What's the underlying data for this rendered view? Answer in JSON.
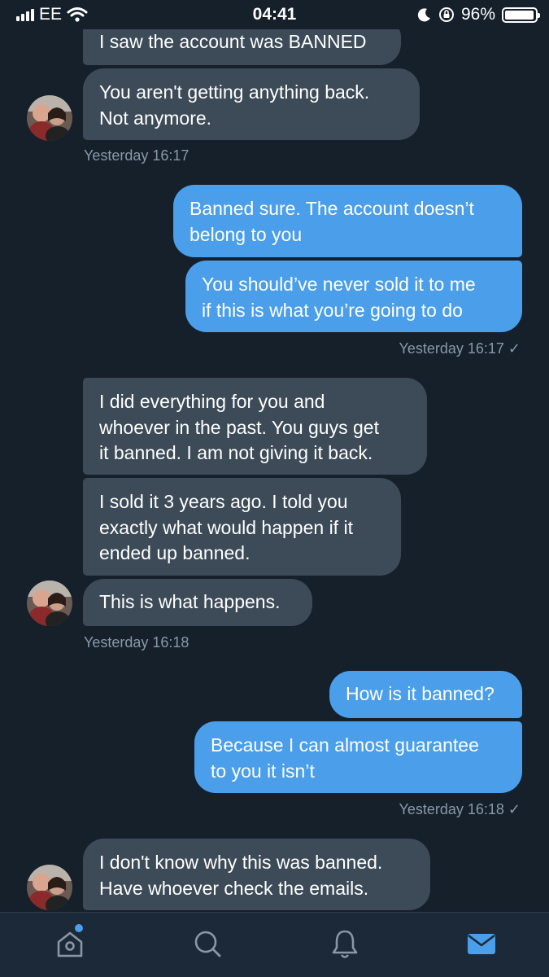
{
  "status_bar": {
    "carrier": "EE",
    "time": "04:41",
    "battery_percent": "96%",
    "battery_level": 0.96
  },
  "conversation": {
    "messages": [
      {
        "text": "I saw the account was BANNED"
      },
      {
        "text": "You aren't getting anything back.\nNot anymore."
      },
      {
        "text": "Banned sure. The account doesn’t\nbelong to you"
      },
      {
        "text": "You should’ve never sold it to me\nif this is what you’re going to do"
      },
      {
        "text": "I did everything for you and\nwhoever in the past. You guys get\nit banned. I am not giving it back."
      },
      {
        "text": "I sold it 3 years ago. I told you\nexactly what would happen if it\nended up banned."
      },
      {
        "text": "This is what happens."
      },
      {
        "text": "How is it banned?"
      },
      {
        "text": "Because I can almost guarantee\nto you it isn’t"
      },
      {
        "text": "I don't know why this was banned.\nHave whoever check the emails."
      }
    ],
    "timestamps": [
      {
        "text": "Yesterday 16:17"
      },
      {
        "text": "Yesterday 16:17 ✓"
      },
      {
        "text": "Yesterday 16:18"
      },
      {
        "text": "Yesterday 16:18 ✓"
      }
    ]
  },
  "tab_bar": {
    "icons": [
      "home-icon",
      "search-icon",
      "notifications-bell-icon",
      "messages-envelope-icon"
    ],
    "active_tab": "messages",
    "home_has_notification_dot": true
  },
  "colors": {
    "background": "#15202b",
    "incoming_bubble": "#3d4b58",
    "outgoing_bubble": "#4a9eea",
    "timestamp": "#8899a6",
    "accent": "#4a9eea"
  }
}
